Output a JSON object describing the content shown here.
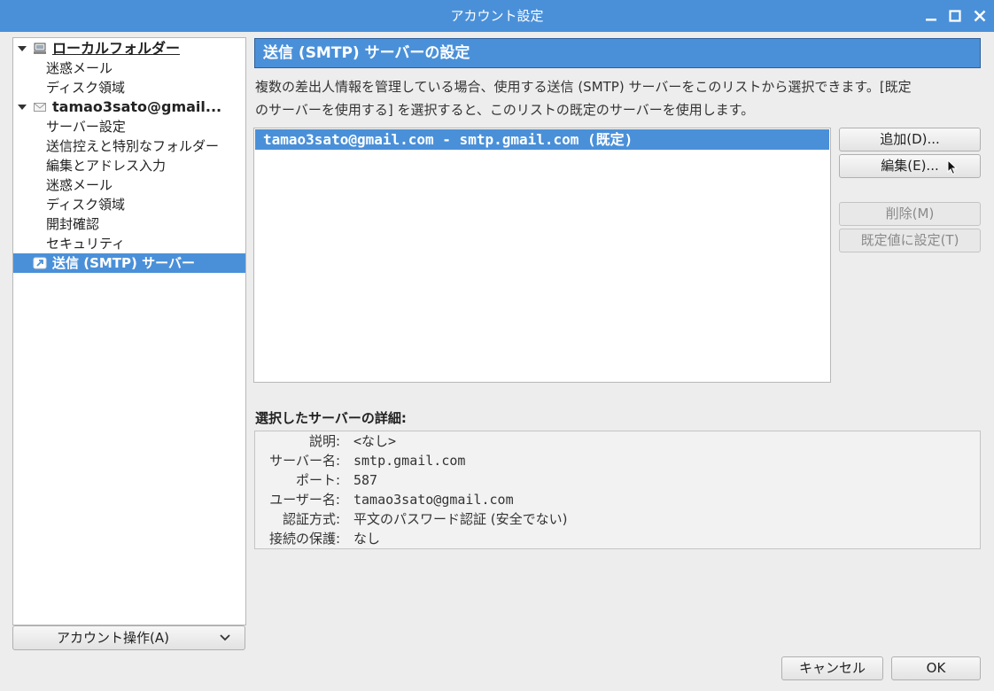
{
  "window": {
    "title": "アカウント設定"
  },
  "tree": {
    "items": [
      {
        "label": "ローカルフォルダー",
        "kind": "account-local"
      },
      {
        "label": "迷惑メール",
        "kind": "child"
      },
      {
        "label": "ディスク領域",
        "kind": "child"
      },
      {
        "label": "tamao3sato@gmail...",
        "kind": "account-mail"
      },
      {
        "label": "サーバー設定",
        "kind": "child"
      },
      {
        "label": "送信控えと特別なフォルダー",
        "kind": "child"
      },
      {
        "label": "編集とアドレス入力",
        "kind": "child"
      },
      {
        "label": "迷惑メール",
        "kind": "child"
      },
      {
        "label": "ディスク領域",
        "kind": "child"
      },
      {
        "label": "開封確認",
        "kind": "child"
      },
      {
        "label": "セキュリティ",
        "kind": "child"
      },
      {
        "label": "送信 (SMTP) サーバー",
        "kind": "smtp",
        "selected": true
      }
    ],
    "account_actions_label": "アカウント操作(A)"
  },
  "pane": {
    "header": "送信 (SMTP) サーバーの設定",
    "description_line1": "複数の差出人情報を管理している場合、使用する送信 (SMTP) サーバーをこのリストから選択できます。[既定",
    "description_line2": "のサーバーを使用する] を選択すると、このリストの既定のサーバーを使用します。",
    "servers": [
      {
        "label": "tamao3sato@gmail.com - smtp.gmail.com (既定)",
        "selected": true
      }
    ],
    "buttons": {
      "add": "追加(D)...",
      "edit": "編集(E)...",
      "delete": "削除(M)",
      "set_default": "既定値に設定(T)"
    },
    "details_title": "選択したサーバーの詳細:",
    "details": [
      {
        "label": "説明:",
        "value": "<なし>"
      },
      {
        "label": "サーバー名:",
        "value": "smtp.gmail.com"
      },
      {
        "label": "ポート:",
        "value": "587"
      },
      {
        "label": "ユーザー名:",
        "value": "tamao3sato@gmail.com"
      },
      {
        "label": "認証方式:",
        "value": "平文のパスワード認証 (安全でない)"
      },
      {
        "label": "接続の保護:",
        "value": "なし"
      }
    ]
  },
  "footer": {
    "cancel": "キャンセル",
    "ok": "OK"
  },
  "colors": {
    "accent": "#4a90d9",
    "window_bg": "#ededed"
  }
}
